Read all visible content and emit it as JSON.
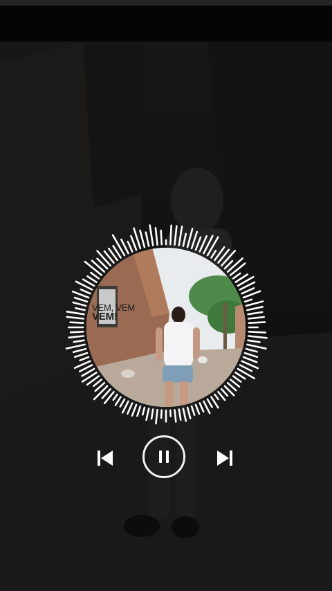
{
  "cover": {
    "caption_line1": "VEM, VEM",
    "caption_line2": "VEM!"
  },
  "icons": {
    "previous": "skip-previous-icon",
    "pause": "pause-icon",
    "next": "skip-next-icon"
  },
  "colors": {
    "accent": "#ffffff",
    "background": "#0d0d0d"
  }
}
